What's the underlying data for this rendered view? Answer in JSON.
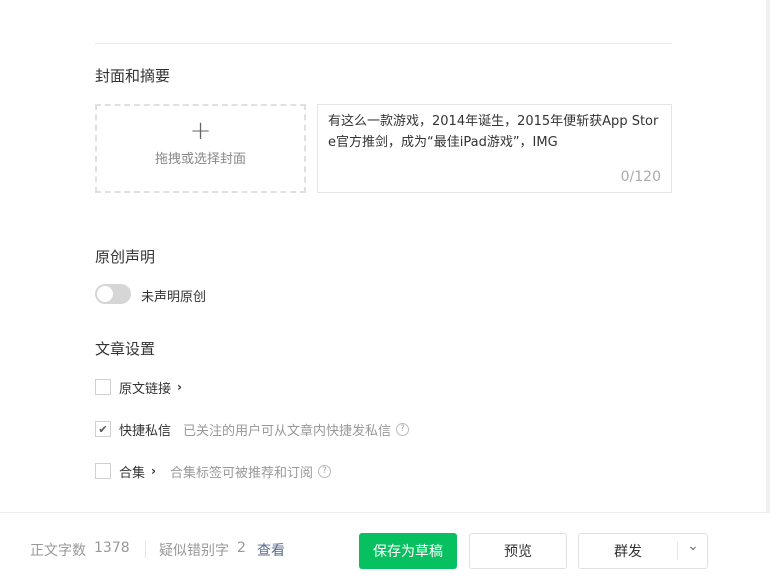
{
  "cover_section": {
    "title": "封面和摘要",
    "cover_label": "拖拽或选择封面",
    "plus": "+"
  },
  "summary": {
    "text": "有这么一款游戏，2014年诞生，2015年便斩获App Store官方推剑，成为“最佳iPad游戏”，IMG",
    "count": "0/120"
  },
  "original": {
    "title": "原创声明",
    "toggle_label": "未声明原创",
    "enabled": false
  },
  "settings": {
    "title": "文章设置",
    "items": [
      {
        "label": "原文链接",
        "arrow": "›",
        "desc": "",
        "checked": false
      },
      {
        "label": "快捷私信",
        "arrow": "",
        "desc": "已关注的用户可从文章内快捷发私信",
        "checked": true
      },
      {
        "label": "合集",
        "arrow": "›",
        "desc": "合集标签可被推荐和订阅",
        "checked": false
      }
    ],
    "help": "?",
    "check": "✔"
  },
  "footer": {
    "word_count_label": "正文字数",
    "word_count": "1378",
    "typo_label": "疑似错别字",
    "typo_count": "2",
    "view_link": "查看",
    "save_draft": "保存为草稿",
    "preview": "预览",
    "mass_send": "群发",
    "dropdown": "⌄"
  },
  "colors": {
    "primary": "#07c160",
    "link": "#576b95"
  }
}
